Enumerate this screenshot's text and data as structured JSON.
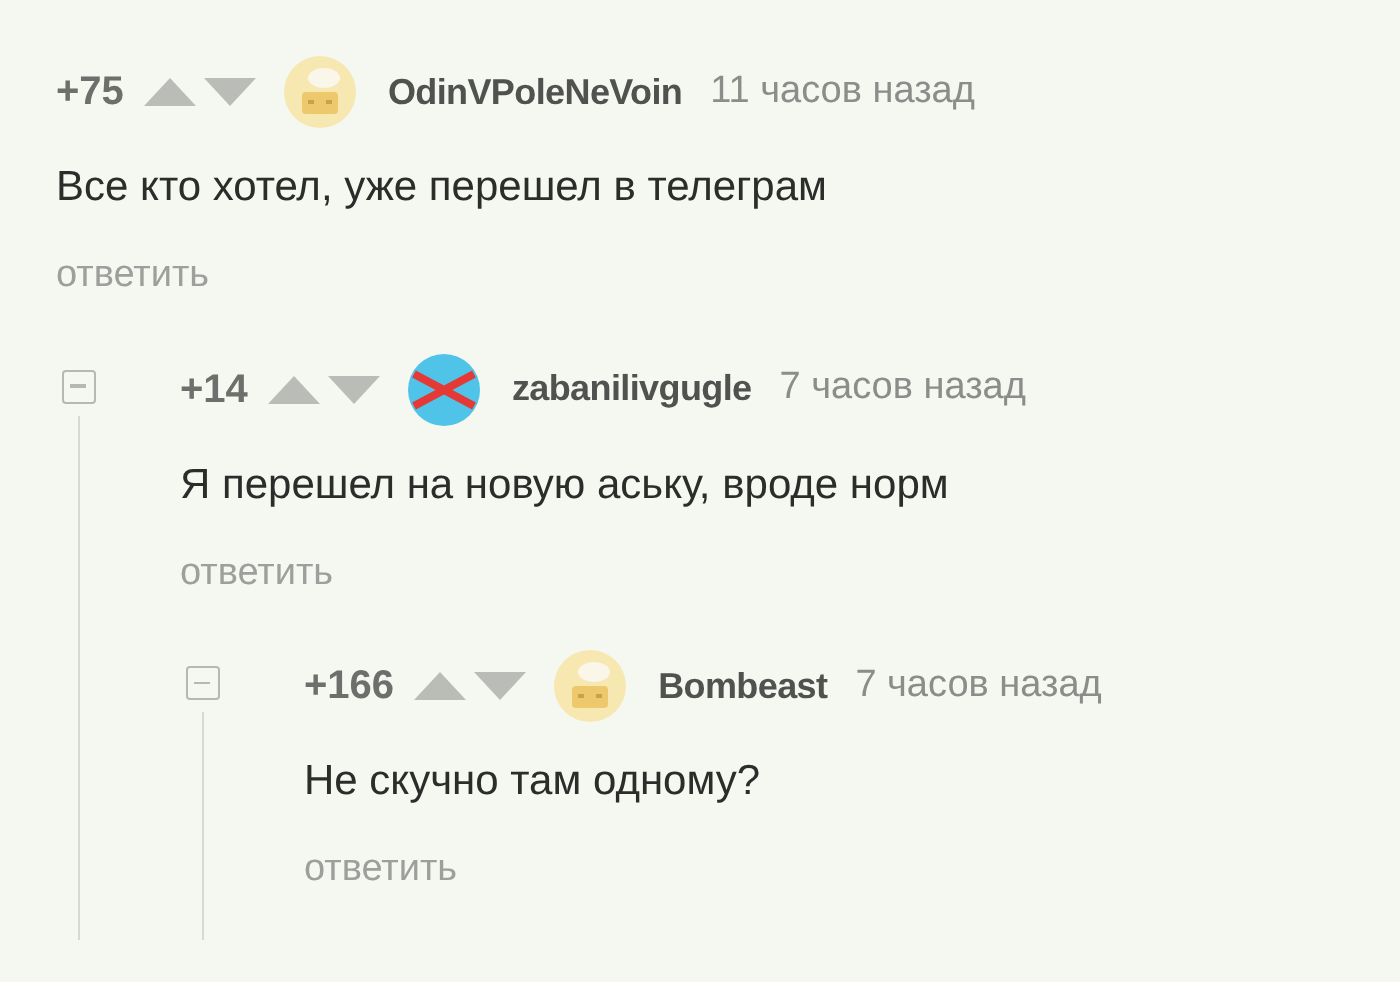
{
  "comments": [
    {
      "rating": "+75",
      "author": "OdinVPoleNeVoin",
      "avatar": {
        "kind": "default"
      },
      "time": "11 часов назад",
      "text": "Все кто хотел, уже перешел в телеграм",
      "reply": "ответить",
      "children": [
        {
          "rating": "+14",
          "author": "zabanilivgugle",
          "avatar": {
            "kind": "crossed"
          },
          "time": "7 часов назад",
          "text": "Я перешел на новую аську, вроде норм",
          "reply": "ответить",
          "expanded": true,
          "children": [
            {
              "rating": "+166",
              "author": "Bombeast",
              "avatar": {
                "kind": "default"
              },
              "time": "7 часов назад",
              "text": "Не скучно там одному?",
              "reply": "ответить",
              "expanded": true
            }
          ]
        }
      ]
    }
  ]
}
